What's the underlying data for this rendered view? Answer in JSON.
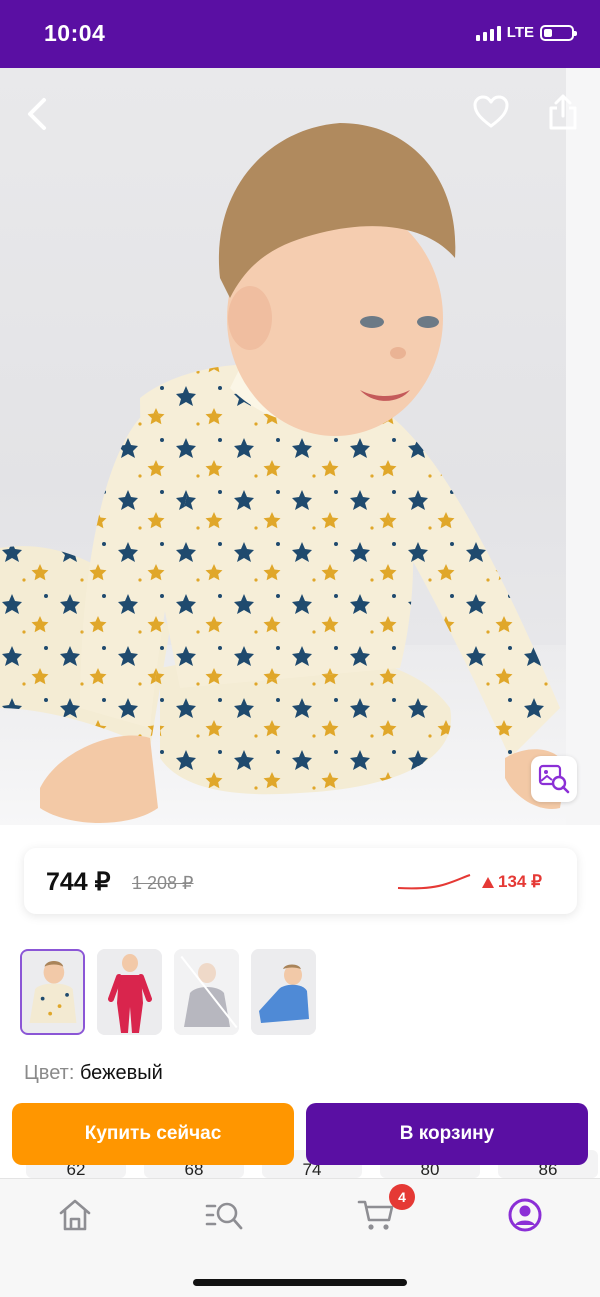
{
  "status_bar": {
    "time": "10:04",
    "network": "LTE",
    "battery_level": 0.3
  },
  "product_image": {
    "description_icon_names": [
      "back-icon",
      "heart-icon",
      "share-icon",
      "visual-search-icon"
    ]
  },
  "price": {
    "current": "744 ₽",
    "old": "1 208 ₽",
    "change": "134 ₽",
    "change_direction": "up",
    "change_color": "#e53935"
  },
  "variants": [
    {
      "color": "бежевый",
      "selected": true,
      "available": true,
      "swatch": "#f3ead2"
    },
    {
      "color": "красный",
      "selected": false,
      "available": true,
      "swatch": "#d9254d"
    },
    {
      "color": "серый",
      "selected": false,
      "available": false,
      "swatch": "#9a9aa2"
    },
    {
      "color": "голубой",
      "selected": false,
      "available": true,
      "swatch": "#4f8ad6"
    }
  ],
  "color_row": {
    "label": "Цвет:",
    "value": "бежевый"
  },
  "size_peek": [
    "62",
    "68",
    "74",
    "80",
    "86"
  ],
  "actions": {
    "buy_now": "Купить сейчас",
    "add_to_cart": "В корзину"
  },
  "tab_bar": {
    "items": [
      "home-icon",
      "catalog-search-icon",
      "cart-icon",
      "profile-icon"
    ],
    "cart_count": "4",
    "active_color": "#8b2fd6"
  },
  "colors": {
    "brand": "#5a0fa3",
    "accent_buy": "#ff9600",
    "price_up": "#e53935"
  }
}
